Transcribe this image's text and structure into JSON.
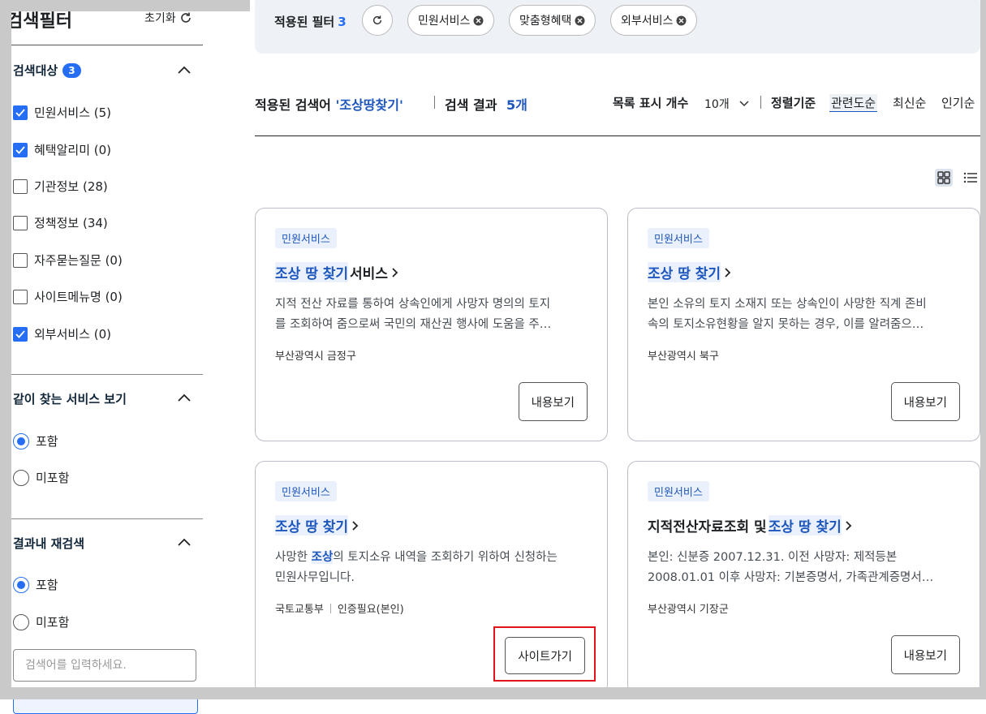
{
  "sidebar": {
    "title": "검색필터",
    "reset_label": "초기화",
    "target_section": {
      "title": "검색대상",
      "badge": "3",
      "options": [
        {
          "label": "민원서비스 (5)",
          "checked": true
        },
        {
          "label": "혜택알리미 (0)",
          "checked": true
        },
        {
          "label": "기관정보 (28)",
          "checked": false
        },
        {
          "label": "정책정보 (34)",
          "checked": false
        },
        {
          "label": "자주묻는질문 (0)",
          "checked": false
        },
        {
          "label": "사이트메뉴명 (0)",
          "checked": false
        },
        {
          "label": "외부서비스 (0)",
          "checked": true
        }
      ]
    },
    "related_section": {
      "title": "같이 찾는 서비스 보기",
      "options": [
        {
          "label": "포함",
          "selected": true
        },
        {
          "label": "미포함",
          "selected": false
        }
      ]
    },
    "research_section": {
      "title": "결과내 재검색",
      "options": [
        {
          "label": "포함",
          "selected": true
        },
        {
          "label": "미포함",
          "selected": false
        }
      ],
      "input_placeholder": "검색어를 입력하세요."
    }
  },
  "filter_bar": {
    "label": "적용된 필터",
    "count": "3",
    "chips": [
      "민원서비스",
      "맞춤형혜택",
      "외부서비스"
    ]
  },
  "results_header": {
    "query_label": "적용된 검색어",
    "query": "'조상땅찾기'",
    "result_label": "검색 결과",
    "result_count": "5개",
    "per_page_label": "목록 표시 개수",
    "per_page_value": "10개",
    "sort_label": "정렬기준",
    "sort_options": [
      "관련도순",
      "최신순",
      "인기순"
    ]
  },
  "cards": [
    {
      "tag": "민원서비스",
      "title_hl": "조상 땅 찾기",
      "title_rest": " 서비스",
      "desc": [
        "지적 전산 자료를 통하여 상속인에게 사망자 명의의 토지",
        "를 조회하여 줌으로써 국민의 재산권 행사에 도움을 주…"
      ],
      "meta": [
        "부산광역시 금정구"
      ],
      "button": "내용보기"
    },
    {
      "tag": "민원서비스",
      "title_hl": "조상 땅 찾기",
      "title_rest": "",
      "desc": [
        "본인 소유의 토지 소재지 또는 상속인이 사망한 직계 존비",
        "속의 토지소유현황을 알지 못하는 경우, 이를 알려줌으…"
      ],
      "meta": [
        "부산광역시 북구"
      ],
      "button": "내용보기"
    },
    {
      "tag": "민원서비스",
      "title_hl": "조상 땅 찾기",
      "title_rest": "",
      "desc_a": "사망한 ",
      "desc_hl": "조상",
      "desc_b": "의 토지소유 내역을 조회하기 위하여 신청하는",
      "desc_line2": "민원사무입니다.",
      "meta": [
        "국토교통부",
        "인증필요(본인)"
      ],
      "button": "사이트가기"
    },
    {
      "tag": "민원서비스",
      "title_pre": "지적전산자료조회 및 ",
      "title_hl": "조상 땅 찾기",
      "desc": [
        "본인: 신분증 2007.12.31. 이전 사망자: 제적등본",
        "2008.01.01 이후 사망자: 기본증명서, 가족관계증명서…"
      ],
      "meta": [
        "부산광역시 기장군"
      ],
      "button": "내용보기"
    }
  ]
}
